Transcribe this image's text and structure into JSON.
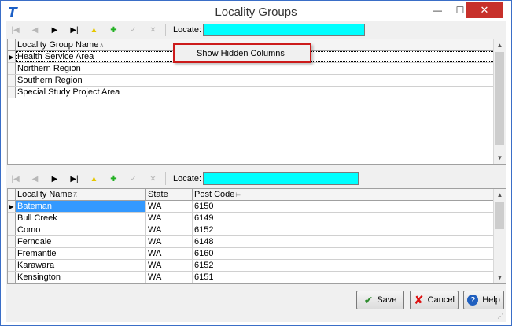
{
  "window": {
    "title": "Locality Groups",
    "min_glyph": "—",
    "max_glyph": "☐",
    "close_glyph": "✕"
  },
  "toolbar_icons": {
    "first": "|◀",
    "prev": "◀",
    "next": "▶",
    "last": "▶|",
    "edit": "▲",
    "add": "✚",
    "post": "✓",
    "cancel": "✕"
  },
  "toolbar_top": {
    "locate_label": "Locate:",
    "locate_value": ""
  },
  "grid_top": {
    "columns": [
      "Locality Group Name"
    ],
    "rows": [
      "Health Service Area",
      "Northern Region",
      "Southern Region",
      "Special Study Project Area"
    ],
    "current_row_marker": "▶"
  },
  "context_menu": {
    "item": "Show Hidden Columns"
  },
  "toolbar_bottom": {
    "locate_label": "Locate:",
    "locate_value": ""
  },
  "grid_bottom": {
    "columns": [
      "Locality Name",
      "State",
      "Post Code"
    ],
    "rows": [
      [
        "Bateman",
        "WA",
        "6150"
      ],
      [
        "Bull Creek",
        "WA",
        "6149"
      ],
      [
        "Como",
        "WA",
        "6152"
      ],
      [
        "Ferndale",
        "WA",
        "6148"
      ],
      [
        "Fremantle",
        "WA",
        "6160"
      ],
      [
        "Karawara",
        "WA",
        "6152"
      ],
      [
        "Kensington",
        "WA",
        "6151"
      ]
    ],
    "current_row_marker": "▶"
  },
  "buttons": {
    "save": "Save",
    "cancel": "Cancel",
    "help": "Help"
  },
  "colors": {
    "locate_bg": "#00ffff",
    "selection": "#3399ff",
    "close_button": "#c7302a",
    "context_border": "#cc1b1b"
  }
}
